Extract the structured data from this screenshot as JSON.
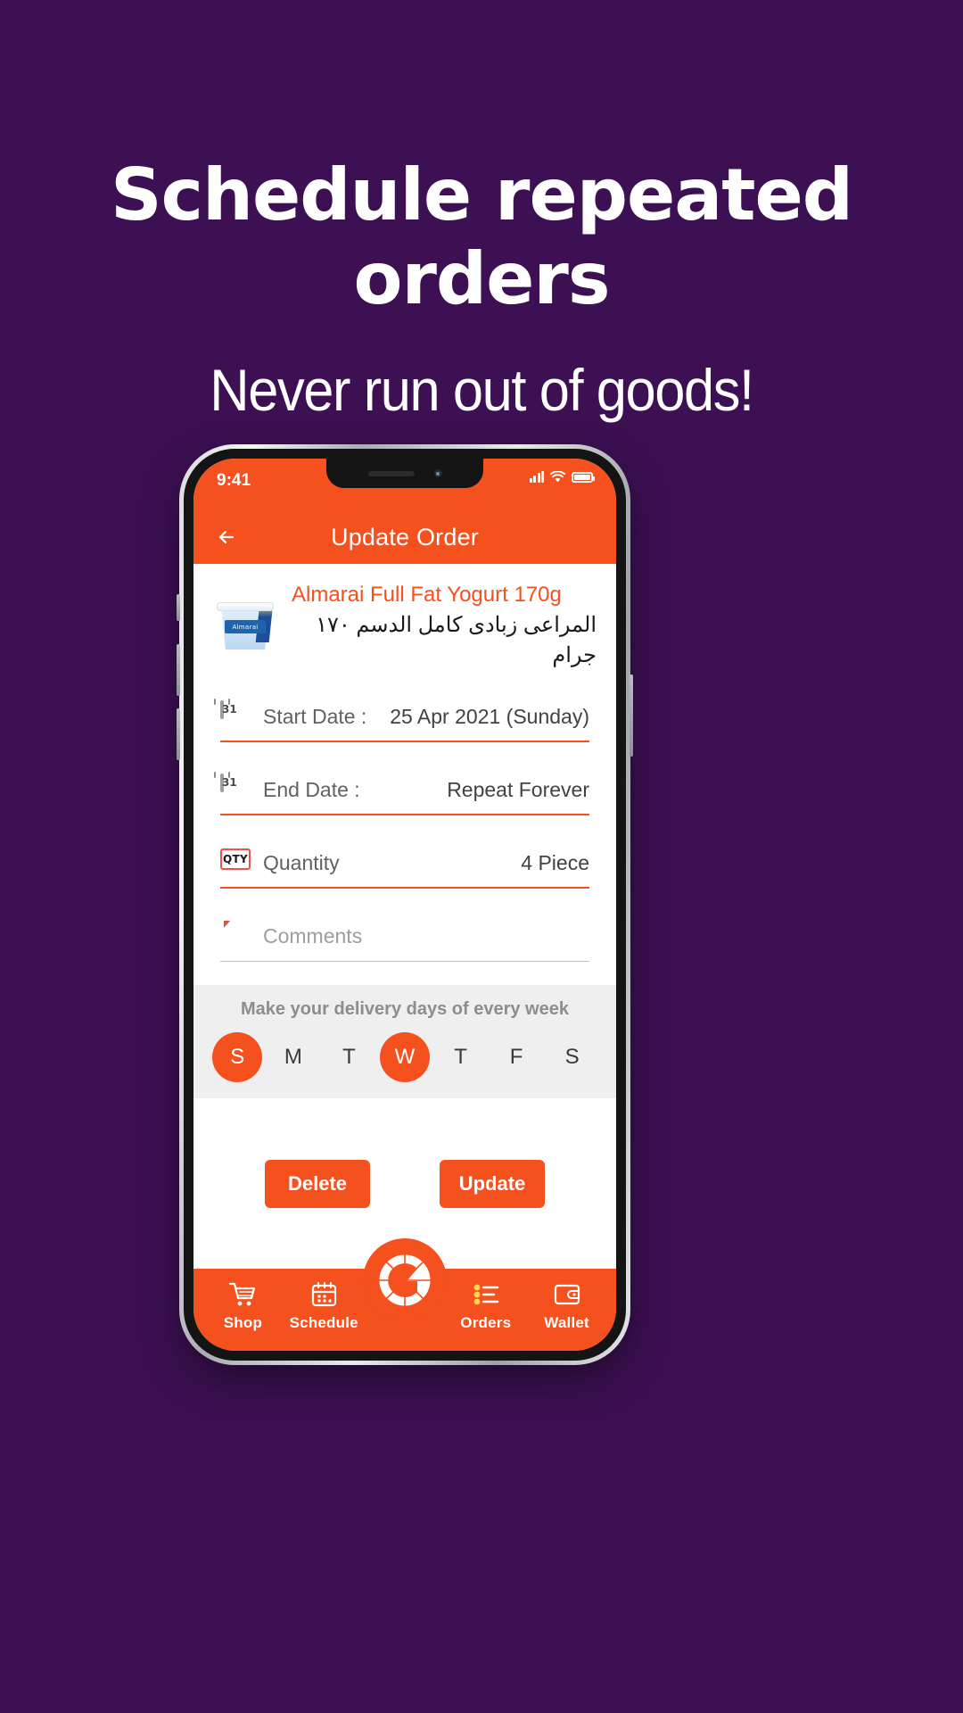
{
  "promo": {
    "headline": "Schedule repeated orders",
    "subheadline": "Never run out of goods!",
    "background_color": "#3C1053",
    "text_color": "#FFFFFF"
  },
  "phone": {
    "status_bar": {
      "time": "9:41",
      "signal_icon": "cellular-signal-icon",
      "wifi_icon": "wifi-icon",
      "battery_icon": "battery-icon"
    },
    "app_bar": {
      "back_icon": "back-arrow-icon",
      "title": "Update Order",
      "background_color": "#F4511E"
    },
    "product": {
      "image_icon": "yogurt-cup-image",
      "brand_on_cup": "Almarai",
      "name": "Almarai Full Fat Yogurt 170g",
      "name_arabic": "المراعى زبادى كامل الدسم ١٧٠ جرام",
      "name_color": "#F4511E"
    },
    "form": {
      "rows": [
        {
          "icon": "calendar-icon",
          "icon_text": "31",
          "label": "Start Date :",
          "value": "25 Apr 2021 (Sunday)",
          "underline": "accent"
        },
        {
          "icon": "calendar-icon",
          "icon_text": "31",
          "label": "End Date :",
          "value": "Repeat Forever",
          "underline": "accent"
        },
        {
          "icon": "qty-icon",
          "icon_text": "QTY",
          "label": "Quantity",
          "value": "4 Piece",
          "underline": "accent"
        },
        {
          "icon": "comment-bubble-icon",
          "icon_text": "",
          "label": "",
          "placeholder": "Comments",
          "value": "",
          "underline": "soft"
        }
      ]
    },
    "days": {
      "title": "Make your delivery days of every week",
      "items": [
        {
          "label": "S",
          "selected": true
        },
        {
          "label": "M",
          "selected": false
        },
        {
          "label": "T",
          "selected": false
        },
        {
          "label": "W",
          "selected": true
        },
        {
          "label": "T",
          "selected": false
        },
        {
          "label": "F",
          "selected": false
        },
        {
          "label": "S",
          "selected": false
        }
      ],
      "selected_color": "#F4511E",
      "background_color": "#EFEFEF"
    },
    "actions": {
      "delete_label": "Delete",
      "update_label": "Update"
    },
    "bottom_nav": {
      "items": [
        {
          "label": "Shop",
          "icon": "shopping-cart-icon"
        },
        {
          "label": "Schedule",
          "icon": "calendar-icon"
        },
        {
          "label": "Orders",
          "icon": "orders-list-icon"
        },
        {
          "label": "Wallet",
          "icon": "wallet-icon"
        }
      ],
      "fab_icon": "brand-logo-icon",
      "background_color": "#F4511E"
    }
  }
}
